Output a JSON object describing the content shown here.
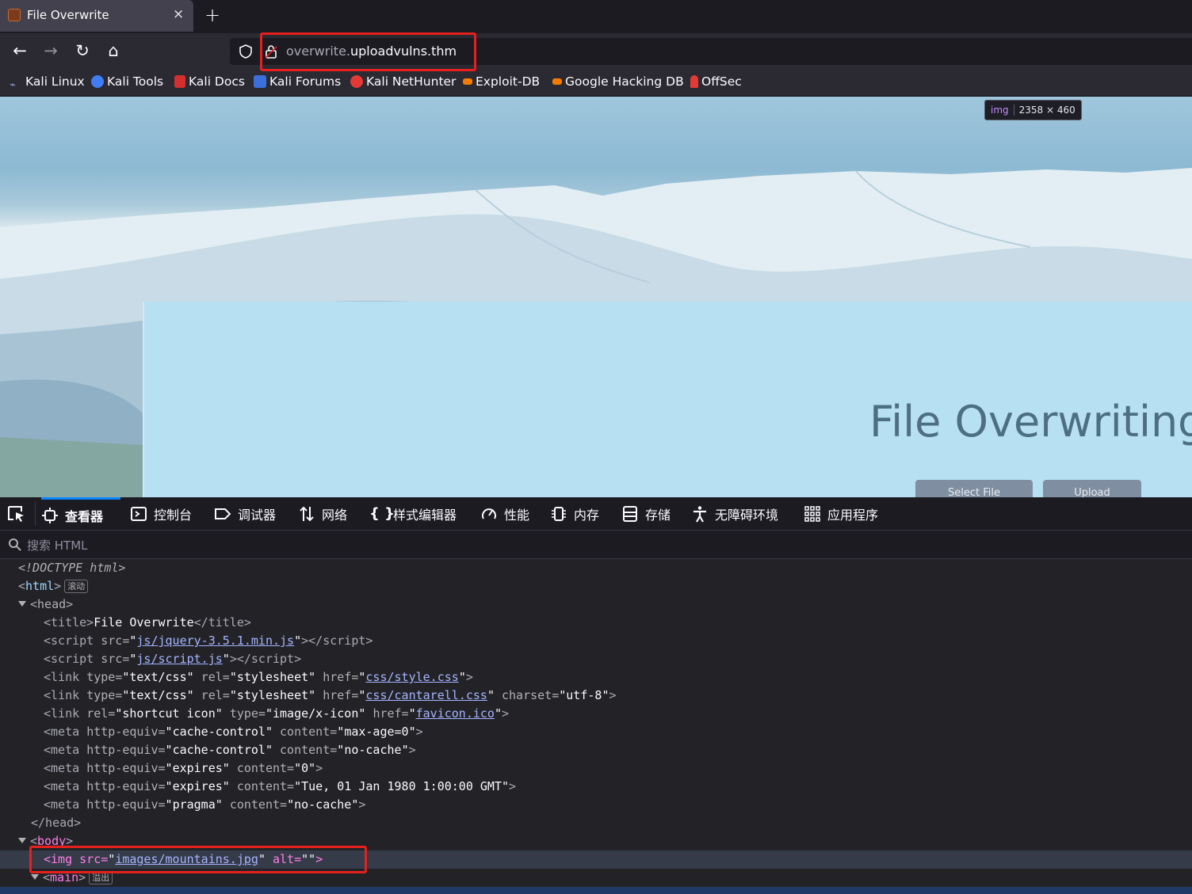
{
  "browser": {
    "tab_title": "File Overwrite",
    "tab_close": "×",
    "new_tab": "+",
    "url_subdomain": "overwrite.",
    "url_host": "uploadvulns.thm",
    "nav": {
      "back": "←",
      "forward": "→",
      "reload": "↻",
      "home": "⌂"
    }
  },
  "bookmarks": [
    {
      "label": "Kali Linux",
      "icon": "kali-dragon-icon",
      "color": "#5c6bc0"
    },
    {
      "label": "Kali Tools",
      "icon": "kali-tools-icon",
      "color": "#3f7ef2"
    },
    {
      "label": "Kali Docs",
      "icon": "kali-docs-icon",
      "color": "#d32f2f"
    },
    {
      "label": "Kali Forums",
      "icon": "kali-forums-icon",
      "color": "#3a6fdc"
    },
    {
      "label": "Kali NetHunter",
      "icon": "nethunter-icon",
      "color": "#e53935"
    },
    {
      "label": "Exploit-DB",
      "icon": "exploit-db-icon",
      "color": "#f57c00"
    },
    {
      "label": "Google Hacking DB",
      "icon": "ghdb-icon",
      "color": "#f57c00"
    },
    {
      "label": "OffSec",
      "icon": "offsec-icon",
      "color": "#e53935"
    }
  ],
  "page": {
    "img_badge_tag": "img",
    "img_badge_dims": "2358 × 460",
    "heading": "File Overwriting",
    "select_button": "Select File",
    "upload_button": "Upload"
  },
  "devtools": {
    "tabs": [
      {
        "label": "查看器",
        "icon": "inspector-icon"
      },
      {
        "label": "控制台",
        "icon": "console-icon"
      },
      {
        "label": "调试器",
        "icon": "debugger-icon"
      },
      {
        "label": "网络",
        "icon": "network-icon"
      },
      {
        "label": "样式编辑器",
        "icon": "style-editor-icon"
      },
      {
        "label": "性能",
        "icon": "performance-icon"
      },
      {
        "label": "内存",
        "icon": "memory-icon"
      },
      {
        "label": "存储",
        "icon": "storage-icon"
      },
      {
        "label": "无障碍环境",
        "icon": "accessibility-icon"
      },
      {
        "label": "应用程序",
        "icon": "application-icon"
      }
    ],
    "search_placeholder": "搜索 HTML",
    "markup": {
      "doctype": "<!DOCTYPE html>",
      "html_badge": "滚动",
      "title_text": "File Overwrite",
      "scripts": [
        "js/jquery-3.5.1.min.js",
        "js/script.js"
      ],
      "link1": {
        "type": "text/css",
        "rel": "stylesheet",
        "href": "css/style.css"
      },
      "link2": {
        "type": "text/css",
        "rel": "stylesheet",
        "href": "css/cantarell.css",
        "charset": "utf-8"
      },
      "link3": {
        "rel": "shortcut icon",
        "type": "image/x-icon",
        "href": "favicon.ico"
      },
      "metas": [
        {
          "equiv": "cache-control",
          "content": "max-age=0"
        },
        {
          "equiv": "cache-control",
          "content": "no-cache"
        },
        {
          "equiv": "expires",
          "content": "0"
        },
        {
          "equiv": "expires",
          "content": "Tue, 01 Jan 1980 1:00:00 GMT"
        },
        {
          "equiv": "pragma",
          "content": "no-cache"
        }
      ],
      "img_src": "images/mountains.jpg",
      "main_badge": "溢出"
    }
  }
}
